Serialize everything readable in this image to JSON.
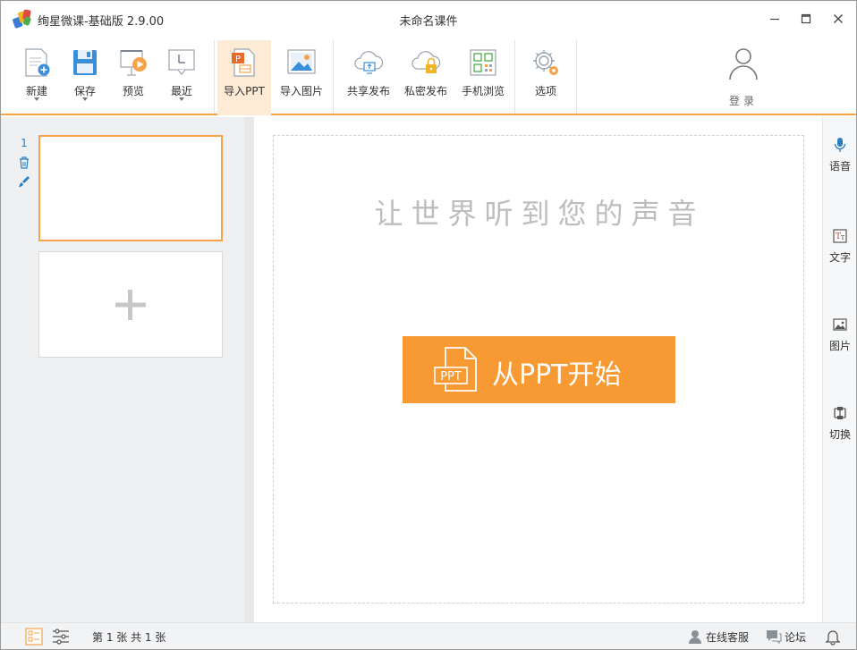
{
  "titlebar": {
    "app_title": "绚星微课-基础版 2.9.00",
    "doc_title": "未命名课件",
    "controls": [
      "minimize-icon",
      "maximize-icon",
      "close-icon"
    ]
  },
  "toolbar": {
    "new_label": "新建",
    "save_label": "保存",
    "preview_label": "预览",
    "recent_label": "最近",
    "import_ppt_label": "导入PPT",
    "import_image_label": "导入图片",
    "share_publish_label": "共享发布",
    "private_publish_label": "私密发布",
    "mobile_preview_label": "手机浏览",
    "options_label": "选项",
    "login_label": "登录",
    "active_item": "导入PPT"
  },
  "slides": {
    "items": [
      {
        "number": "1"
      }
    ],
    "tools": [
      "trash-icon",
      "brush-icon"
    ]
  },
  "canvas": {
    "headline": "让世界听到您的声音",
    "start_label": "从PPT开始",
    "ppt_icon_text": "PPT"
  },
  "right_bar": {
    "voice_label": "语音",
    "text_label": "文字",
    "image_label": "图片",
    "transition_label": "切换"
  },
  "status": {
    "page_info": "第 1 张  共 1 张",
    "support_label": "在线客服",
    "forum_label": "论坛"
  },
  "colors": {
    "accent": "#f89a34",
    "accent_border": "#f5a24b",
    "active_bg": "#fdebd5",
    "link_blue": "#2a7fc1"
  }
}
